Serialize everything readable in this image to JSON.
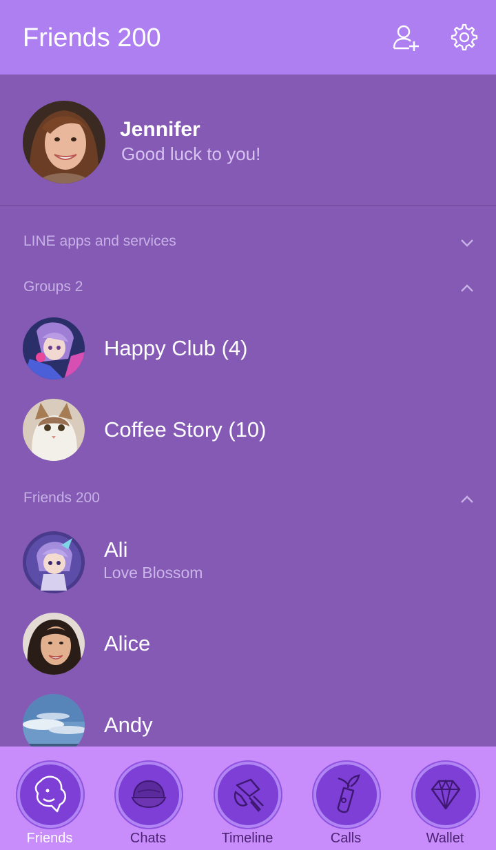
{
  "header": {
    "title": "Friends 200",
    "add_friend_icon": "add-friend-icon",
    "settings_icon": "gear-icon"
  },
  "profile": {
    "name": "Jennifer",
    "status": "Good luck to you!"
  },
  "sections": {
    "line_apps": {
      "label": "LINE apps and services",
      "state": "collapsed"
    },
    "groups": {
      "label": "Groups 2",
      "state": "expanded"
    },
    "friends": {
      "label": "Friends 200",
      "state": "expanded"
    }
  },
  "groups": [
    {
      "name": "Happy Club (4)"
    },
    {
      "name": "Coffee Story (10)"
    }
  ],
  "friends": [
    {
      "name": "Ali",
      "status": "Love Blossom"
    },
    {
      "name": "Alice"
    },
    {
      "name": "Andy"
    }
  ],
  "tabs": [
    {
      "label": "Friends",
      "icon": "friends-icon",
      "active": true
    },
    {
      "label": "Chats",
      "icon": "chats-icon"
    },
    {
      "label": "Timeline",
      "icon": "timeline-icon"
    },
    {
      "label": "Calls",
      "icon": "calls-icon"
    },
    {
      "label": "Wallet",
      "icon": "wallet-icon"
    }
  ],
  "colors": {
    "header": "#ae7ff0",
    "background": "#845ab4",
    "tabbar": "#c98cfb",
    "tab_circle": "#7e3fd6"
  }
}
